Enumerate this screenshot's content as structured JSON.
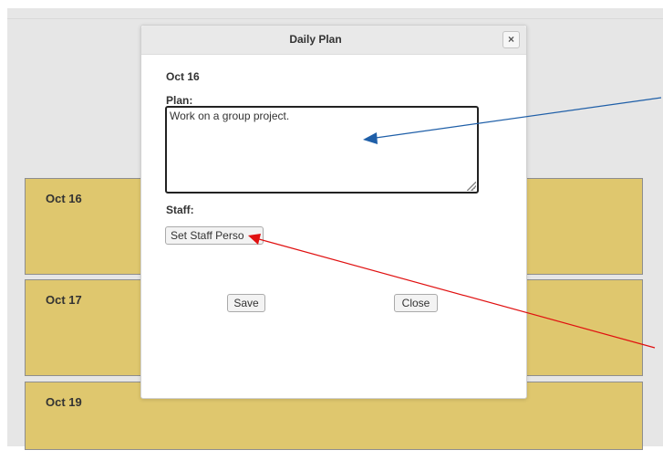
{
  "days": [
    {
      "label": "Oct 16"
    },
    {
      "label": "Oct 17"
    },
    {
      "label": "Oct 19"
    }
  ],
  "dialog": {
    "title": "Daily Plan",
    "close_icon": "×",
    "date": "Oct 16",
    "plan_label": "Plan:",
    "plan_value": "Work on a group project.",
    "staff_label": "Staff:",
    "set_staff_button": "Set Staff Perso",
    "save_button": "Save",
    "close_button": "Close"
  },
  "colors": {
    "day_card": "#dfc76e",
    "background": "#e6e6e6",
    "annotation_blue": "#1f5fa8",
    "annotation_red": "#e01010"
  }
}
